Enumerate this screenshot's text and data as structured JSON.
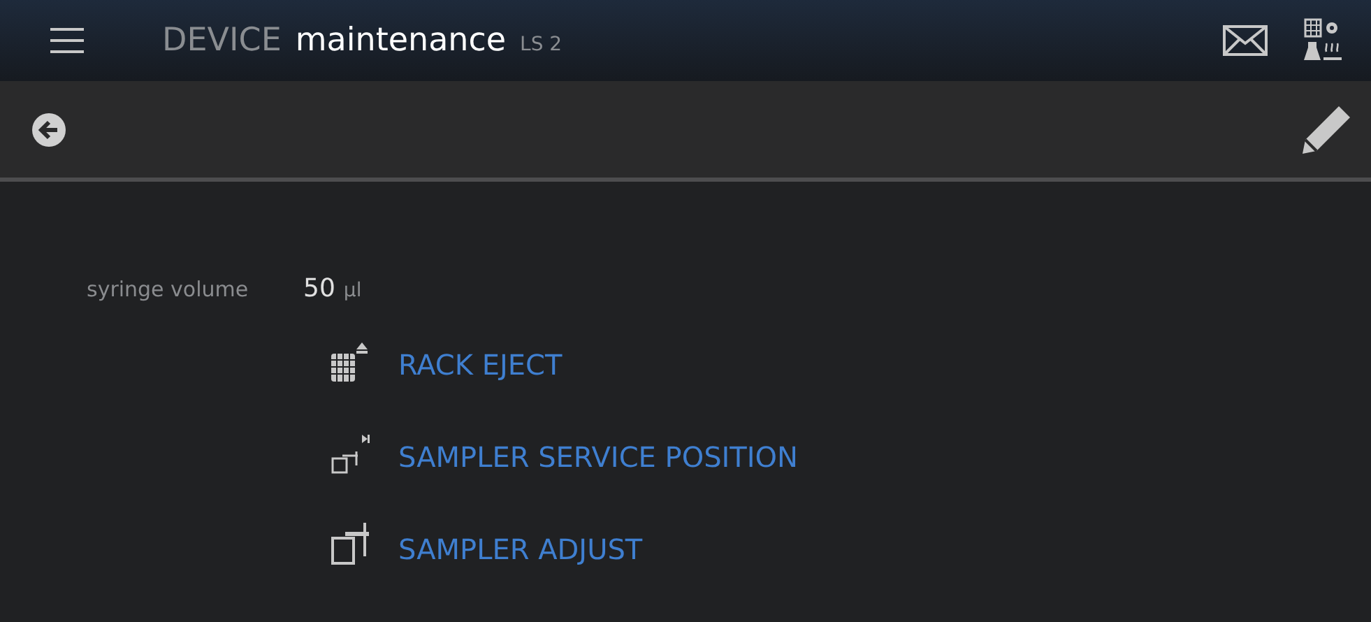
{
  "header": {
    "title_prefix": "DEVICE",
    "title": "maintenance",
    "device": "LS 2"
  },
  "settings": [
    {
      "label": "syringe volume",
      "value": "50",
      "unit": "µl"
    }
  ],
  "actions": [
    {
      "kind": "rack",
      "label": "RACK EJECT"
    },
    {
      "kind": "service",
      "label": "SAMPLER SERVICE POSITION"
    },
    {
      "kind": "adjust",
      "label": "SAMPLER ADJUST"
    }
  ]
}
